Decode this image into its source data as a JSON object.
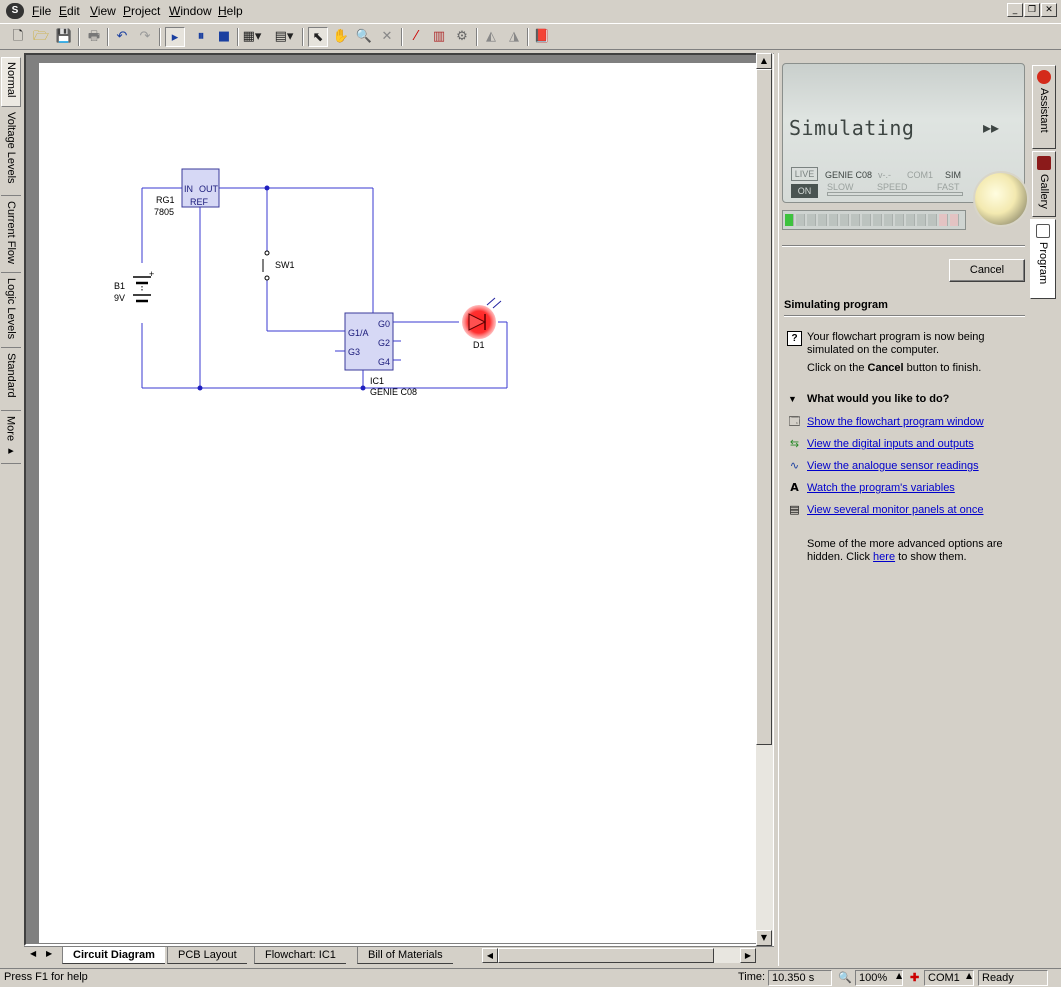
{
  "menu": [
    "File",
    "Edit",
    "View",
    "Project",
    "Window",
    "Help"
  ],
  "window_controls": [
    "_",
    "❐",
    "✕"
  ],
  "left_tabs": [
    "Normal",
    "Voltage Levels",
    "Current Flow",
    "Logic Levels",
    "Standard",
    "More ▸"
  ],
  "circuit": {
    "regulator": {
      "name": "RG1",
      "part": "7805",
      "pins": [
        "IN",
        "OUT",
        "REF"
      ]
    },
    "battery": {
      "name": "B1",
      "value": "9V",
      "plus": "+"
    },
    "switch": {
      "name": "SW1"
    },
    "chip": {
      "name": "IC1",
      "part": "GENIE C08",
      "pins_left": [
        "G1/A",
        "G3"
      ],
      "pins_right": [
        "G0",
        "G2",
        "G4"
      ]
    },
    "led": {
      "name": "D1"
    }
  },
  "bottom_tabs": [
    "Circuit Diagram",
    "PCB Layout",
    "Flowchart: IC1",
    "Bill of Materials"
  ],
  "sim_panel": {
    "title": "Simulating",
    "ff": "▸▸",
    "live": "LIVE",
    "on": "ON",
    "device": "GENIE C08",
    "ver": "v-.-",
    "port": "COM1",
    "mode": "SIM",
    "slow": "SLOW",
    "speed": "SPEED",
    "fast": "FAST"
  },
  "cancel_label": "Cancel",
  "panel": {
    "heading": "Simulating program",
    "para1": "Your flowchart program is now being simulated on the computer.",
    "para2_pre": "Click on the ",
    "para2_bold": "Cancel",
    "para2_post": " button to finish.",
    "question": "What would you like to do?",
    "links": [
      "Show the flowchart program window ",
      "View the digital inputs and outputs ",
      "View the analogue sensor readings",
      "Watch the program's variables",
      "View several monitor panels at once"
    ],
    "footer_pre": "Some of the more advanced options are hidden. Click ",
    "footer_link": "here",
    "footer_post": " to show them."
  },
  "right_tabs": [
    "Assistant",
    "Gallery",
    "Program"
  ],
  "status": {
    "help": "Press F1 for help",
    "time_label": "Time:",
    "time_value": "10.350 s",
    "zoom": "100%",
    "port": "COM1",
    "state": "Ready"
  }
}
